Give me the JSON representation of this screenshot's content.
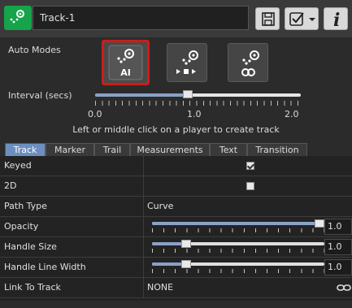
{
  "header": {
    "track_name": "Track-1",
    "icons": [
      "track-icon",
      "save-icon",
      "checkbox-icon",
      "chevron-down-icon",
      "info-icon"
    ],
    "info_label": "i"
  },
  "auto_modes": {
    "label": "Auto Modes",
    "buttons": [
      {
        "name": "ai",
        "text": "AI",
        "selected": true
      },
      {
        "name": "player",
        "text": "",
        "selected": false
      },
      {
        "name": "link",
        "text": "",
        "selected": false
      }
    ]
  },
  "interval": {
    "label": "Interval (secs)",
    "value": 0.9,
    "min": 0.0,
    "max": 2.0,
    "tick_labels": [
      "0.0",
      "1.0",
      "2.0"
    ]
  },
  "hint": "Left or middle click on a player to create track",
  "tabs": [
    "Track",
    "Marker",
    "Trail",
    "Measurements",
    "Text",
    "Transition"
  ],
  "active_tab": "Track",
  "properties": [
    {
      "name": "Keyed",
      "type": "checkbox",
      "checked": true
    },
    {
      "name": "2D",
      "type": "checkbox",
      "checked": false
    },
    {
      "name": "Path Type",
      "type": "text",
      "value": "Curve"
    },
    {
      "name": "Opacity",
      "type": "slider",
      "value": "1.0",
      "fraction": 1.0
    },
    {
      "name": "Handle Size",
      "type": "slider",
      "value": "1.0",
      "fraction": 0.2
    },
    {
      "name": "Handle Line Width",
      "type": "slider",
      "value": "1.0",
      "fraction": 0.2
    },
    {
      "name": "Link To Track",
      "type": "link",
      "value": "NONE"
    }
  ],
  "colors": {
    "accent_green": "#16a34a",
    "selected_outline": "#d21a1a",
    "active_tab": "#6d8fc0"
  }
}
